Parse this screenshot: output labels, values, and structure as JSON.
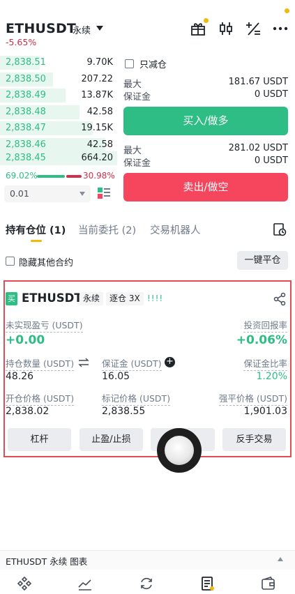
{
  "header": {
    "symbol": "ETHUSDT",
    "contract_type": "永续",
    "change_pct": "-5.65%",
    "icons": [
      "gift-icon",
      "candlestick-icon",
      "calculator-icon",
      "more-icon"
    ]
  },
  "orderbook": {
    "bids": [
      {
        "price": "2,838.51",
        "qty": "9.70K",
        "depth": 0.34
      },
      {
        "price": "2,838.50",
        "qty": "207.22",
        "depth": 0.45
      },
      {
        "price": "2,838.49",
        "qty": "13.87K",
        "depth": 0.56
      },
      {
        "price": "2,838.48",
        "qty": "42.58",
        "depth": 0.68
      },
      {
        "price": "2,838.47",
        "qty": "19.15K",
        "depth": 0.79
      },
      {
        "price": "2,838.46",
        "qty": "42.58",
        "depth": 0.9
      },
      {
        "price": "2,838.45",
        "qty": "664.20",
        "depth": 1.0
      }
    ],
    "buy_ratio": "69.02%",
    "sell_ratio": "30.98%",
    "precision": "0.01"
  },
  "order_form": {
    "reduce_only_label": "只减仓",
    "buy_max_label": "最大",
    "buy_max_value": "181.67 USDT",
    "buy_margin_label": "保证金",
    "buy_margin_value": "0 USDT",
    "buy_button": "买入/做多",
    "sell_max_label": "最大",
    "sell_max_value": "281.02 USDT",
    "sell_margin_label": "保证金",
    "sell_margin_value": "0 USDT",
    "sell_button": "卖出/做空"
  },
  "tabs": [
    {
      "label": "持有仓位 (1)",
      "active": true
    },
    {
      "label": "当前委托 (2)",
      "active": false
    },
    {
      "label": "交易机器人",
      "active": false
    }
  ],
  "hide_other_label": "隐藏其他合约",
  "close_all_label": "一键平仓",
  "position": {
    "side_badge": "买",
    "symbol": "ETHUSDT",
    "type": "永续",
    "margin_mode": "逐仓 3X",
    "lev_bars": "!!!!",
    "unrealized_pnl_label": "未实现盈亏 (USDT)",
    "unrealized_pnl": "+0.00",
    "roi_label": "投资回报率",
    "roi": "+0.06%",
    "size_label": "持仓数量 (USDT)",
    "size": "48.26",
    "margin_label": "保证金 (USDT)",
    "margin": "16.05",
    "margin_ratio_label": "保证金比率",
    "margin_ratio": "1.20%",
    "entry_label": "开仓价格 (USDT)",
    "entry": "2,838.02",
    "mark_label": "标记价格 (USDT)",
    "mark": "2,838.55",
    "liq_label": "强平价格 (USDT)",
    "liq": "1,901.03",
    "buttons": {
      "leverage": "杠杆",
      "tpsl": "止盈/止损",
      "reverse": "反手交易"
    }
  },
  "chart_bar_label": "ETHUSDT 永续  图表",
  "bottom_nav": [
    "home-icon",
    "markets-icon",
    "trade-icon",
    "futures-icon",
    "wallet-icon"
  ]
}
